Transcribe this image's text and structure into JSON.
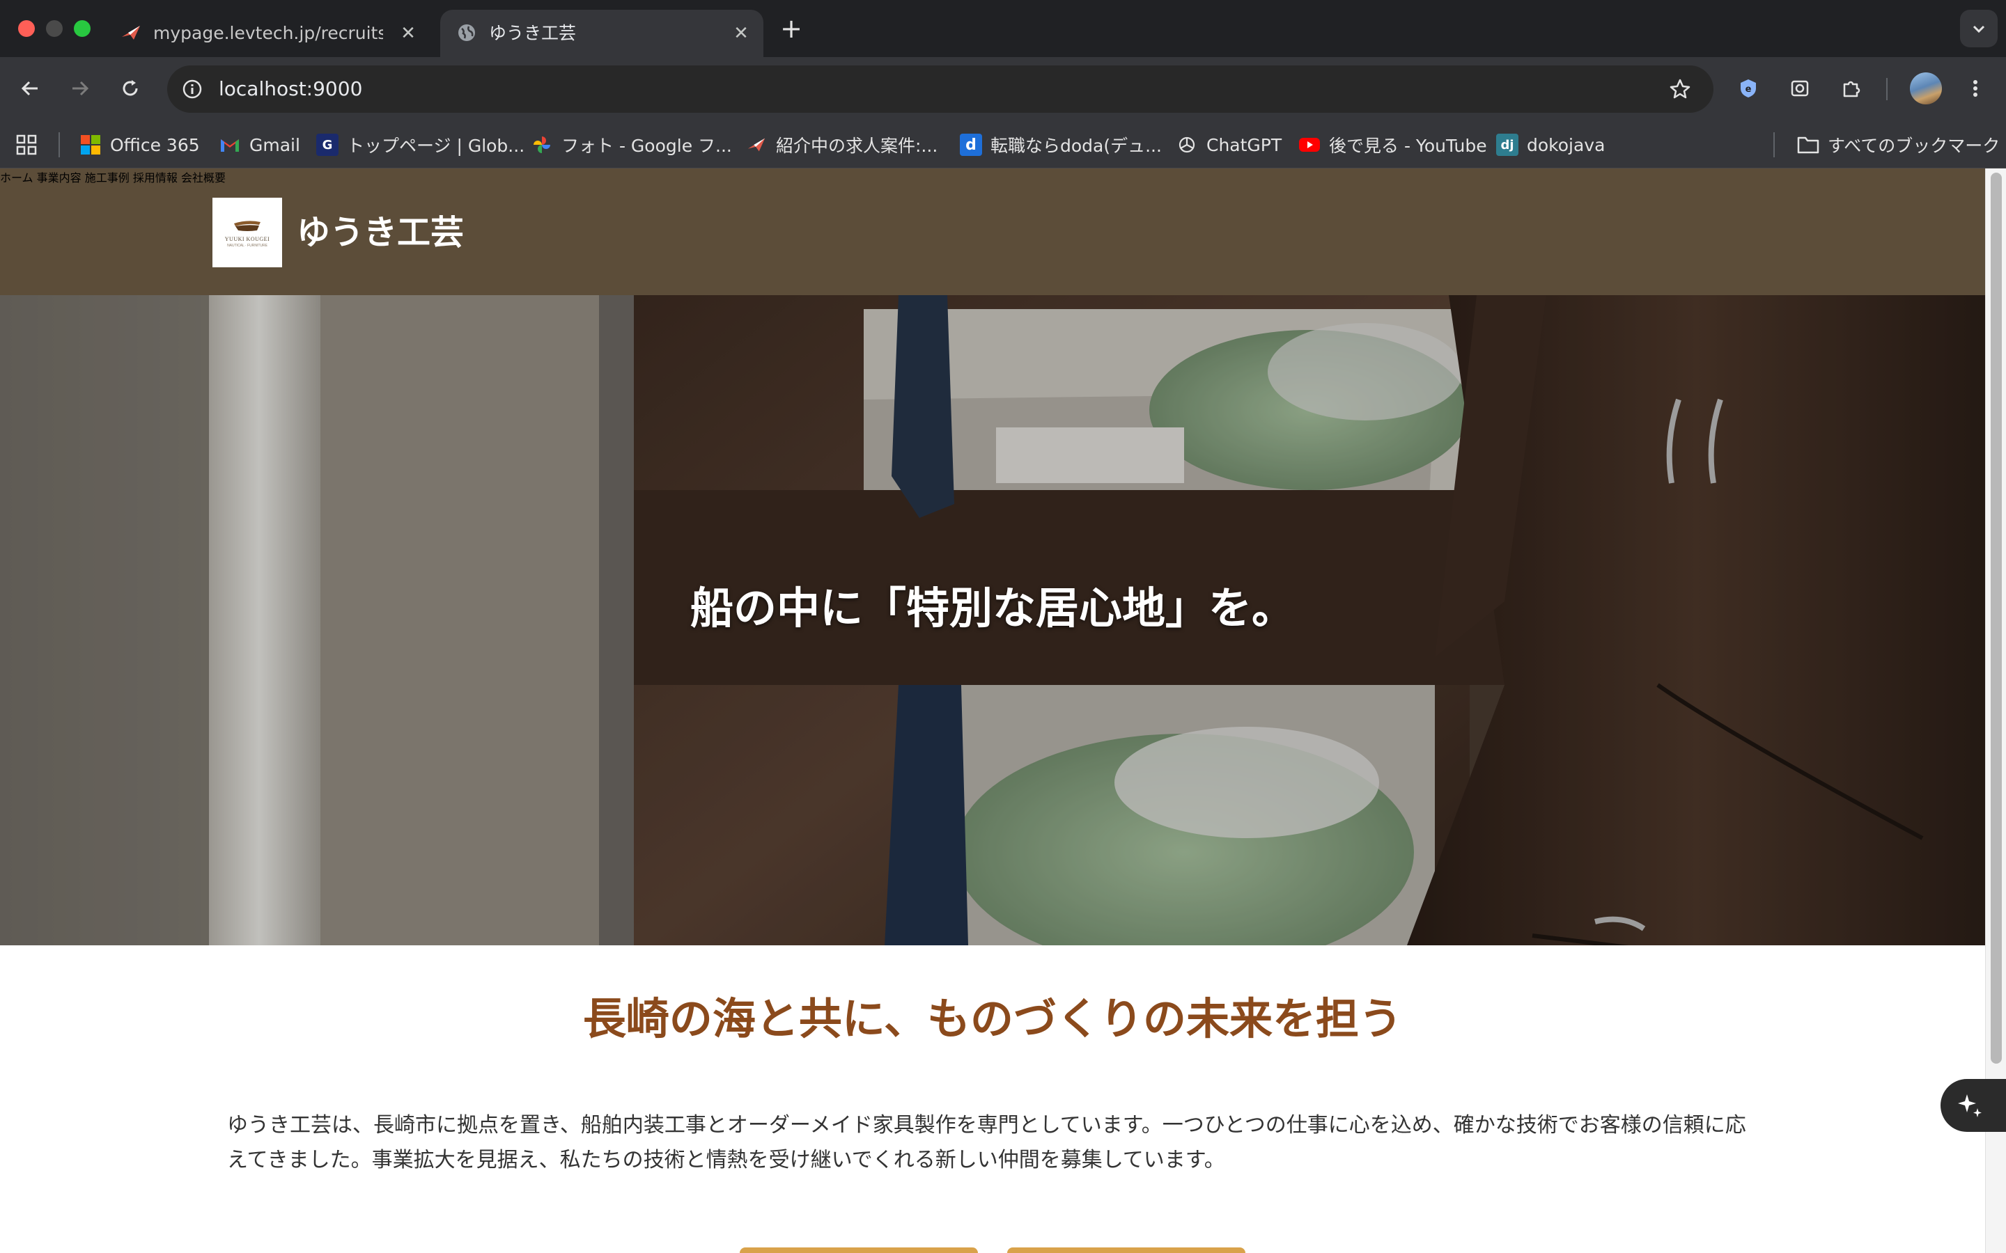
{
  "browser": {
    "tabs": [
      {
        "title": "mypage.levtech.jp/recruits/sc",
        "active": false
      },
      {
        "title": "ゆうき工芸",
        "active": true
      }
    ],
    "url": "localhost:9000",
    "bookmarks": [
      {
        "label": "Office 365",
        "icon": "microsoft-icon"
      },
      {
        "label": "Gmail",
        "icon": "gmail-icon"
      },
      {
        "label": "トップページ | Glob...",
        "icon": "globis-icon"
      },
      {
        "label": "フォト - Google フ...",
        "icon": "google-photos-icon"
      },
      {
        "label": "紹介中の求人案件:...",
        "icon": "levtech-icon"
      },
      {
        "label": "転職ならdoda(デュ...",
        "icon": "doda-icon"
      },
      {
        "label": "ChatGPT",
        "icon": "chatgpt-icon"
      },
      {
        "label": "後で見る - YouTube",
        "icon": "youtube-icon"
      },
      {
        "label": "dokojava",
        "icon": "dokojava-icon"
      }
    ],
    "all_bookmarks_label": "すべてのブックマーク"
  },
  "site": {
    "name": "ゆうき工芸",
    "logo_text": "YUUKI KOUGEI",
    "logo_sub": "NAUTICAL · FURNITURE",
    "nav": [
      "ホーム",
      "事業内容",
      "施工事例",
      "採用情報",
      "会社概要"
    ],
    "hero_text": "船の中に「特別な居心地」を。",
    "section_title": "長崎の海と共に、ものづくりの未来を担う",
    "intro": "ゆうき工芸は、長崎市に拠点を置き、船舶内装工事とオーダーメイド家具製作を専門としています。一つひとつの仕事に心を込め、確かな技術でお客様の信頼に応えてきました。事業拡大を見据え、私たちの技術と情熱を受け継いでくれる新しい仲間を募集しています。"
  },
  "colors": {
    "header_bg": "#5c4d39",
    "accent_title": "#8b4a1c",
    "button_accent": "#d9a24a"
  }
}
